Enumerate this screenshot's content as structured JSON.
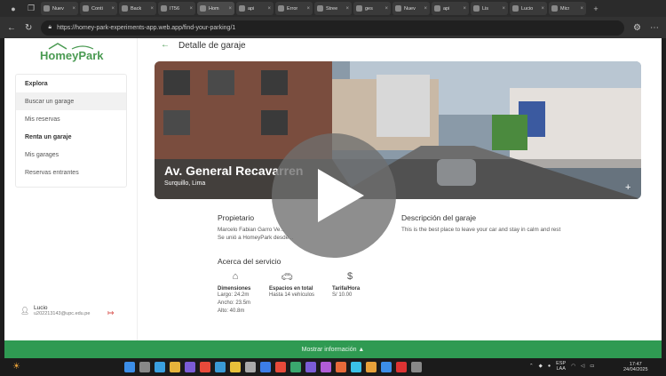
{
  "browser": {
    "tabs": [
      {
        "label": "Nuev",
        "active": false
      },
      {
        "label": "Conti",
        "active": false
      },
      {
        "label": "Back",
        "active": false
      },
      {
        "label": "IT56",
        "active": false
      },
      {
        "label": "Hom",
        "active": true
      },
      {
        "label": "api",
        "active": false
      },
      {
        "label": "Error",
        "active": false
      },
      {
        "label": "Stree",
        "active": false
      },
      {
        "label": "ges",
        "active": false
      },
      {
        "label": "Nuev",
        "active": false
      },
      {
        "label": "api",
        "active": false
      },
      {
        "label": "Lis",
        "active": false
      },
      {
        "label": "Lucio",
        "active": false
      },
      {
        "label": "Micr",
        "active": false
      }
    ],
    "url": "https://homey-park-experiments-app.web.app/find-your-parking/1"
  },
  "sidebar": {
    "logo": "HomeyPark",
    "items": [
      {
        "label": "Explora",
        "type": "head"
      },
      {
        "label": "Buscar un garage",
        "type": "item",
        "selected": true
      },
      {
        "label": "Mis reservas",
        "type": "item"
      },
      {
        "label": "Renta un garaje",
        "type": "head"
      },
      {
        "label": "Mis garages",
        "type": "item"
      },
      {
        "label": "Reservas entrantes",
        "type": "item"
      }
    ],
    "user": {
      "name": "Lucio",
      "email": "u202213143@upc.edu.pe"
    }
  },
  "main": {
    "page_title": "Detalle de garaje",
    "hero": {
      "title": "Av. General Recavarren",
      "subtitle": "Surquillo, Lima"
    },
    "owner": {
      "heading": "Propietario",
      "name": "Marcelo Fabian Garro Ve...",
      "joined": "Se unió a HomeyPark desde..."
    },
    "description": {
      "heading": "Descripción del garaje",
      "text": "This is the best place to leave your car and stay in calm and rest"
    },
    "service": {
      "heading": "Acerca del servicio",
      "items": [
        {
          "icon": "house-icon",
          "label": "Dimensiones",
          "lines": [
            "Largo: 24.2m",
            "Ancho: 23.5m",
            "Alto: 40.8m"
          ]
        },
        {
          "icon": "car-icon",
          "label": "Espacios en total",
          "lines": [
            "Hasta 14 vehículos"
          ]
        },
        {
          "icon": "dollar-icon",
          "label": "Tarifa/Hora",
          "lines": [
            "S/ 10.00"
          ]
        }
      ]
    },
    "footer_button": "Mostrar información ▲"
  },
  "taskbar": {
    "language": "ESP",
    "lang_sub": "LAA",
    "time": "17:47",
    "date": "24/04/2025"
  },
  "colors": {
    "brand": "#2f9a52",
    "logout": "#d9534f"
  }
}
